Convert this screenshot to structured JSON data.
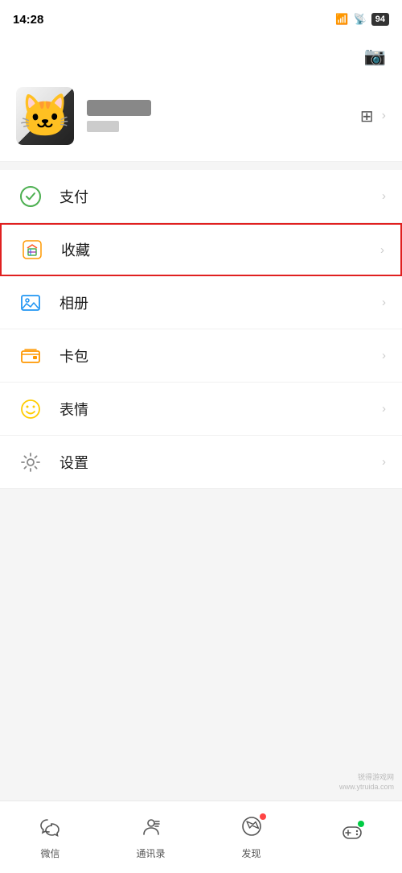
{
  "statusBar": {
    "time": "14:28",
    "battery": "94",
    "batteryLabel": "94"
  },
  "header": {
    "cameraIcon": "📷"
  },
  "profile": {
    "qrHint": "二维码",
    "chevron": "›"
  },
  "menu": {
    "items": [
      {
        "id": "payment",
        "label": "支付",
        "highlighted": false
      },
      {
        "id": "favorites",
        "label": "收藏",
        "highlighted": true
      },
      {
        "id": "album",
        "label": "相册",
        "highlighted": false
      },
      {
        "id": "wallet",
        "label": "卡包",
        "highlighted": false
      },
      {
        "id": "emoji",
        "label": "表情",
        "highlighted": false
      },
      {
        "id": "settings",
        "label": "设置",
        "highlighted": false
      }
    ]
  },
  "bottomNav": {
    "items": [
      {
        "id": "wechat",
        "label": "微信"
      },
      {
        "id": "contacts",
        "label": "通讯录"
      },
      {
        "id": "discover",
        "label": "发现"
      },
      {
        "id": "me",
        "label": ""
      }
    ]
  },
  "watermark": {
    "line1": "锐得游戏网",
    "line2": "www.ytruida.com"
  }
}
